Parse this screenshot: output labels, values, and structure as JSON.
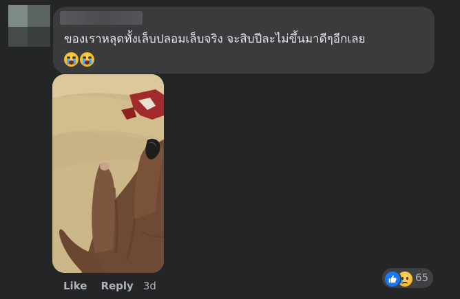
{
  "comment": {
    "text": "ของเราหลุดทั้งเล็บปลอมเล็บจริง จะสิบปีละไม่ขึ้นมาดีๆอีกเลย",
    "emojis": [
      "crying-face-emoji",
      "crying-face-emoji"
    ]
  },
  "actions": {
    "like_label": "Like",
    "reply_label": "Reply",
    "timestamp": "3d"
  },
  "reactions": {
    "types": [
      "like",
      "sad"
    ],
    "count": "65"
  },
  "colors": {
    "background": "#242526",
    "bubble": "#3a3b3c",
    "text_primary": "#e4e6eb",
    "text_secondary": "#b0b3b8",
    "like_blue": "#1877f2"
  }
}
